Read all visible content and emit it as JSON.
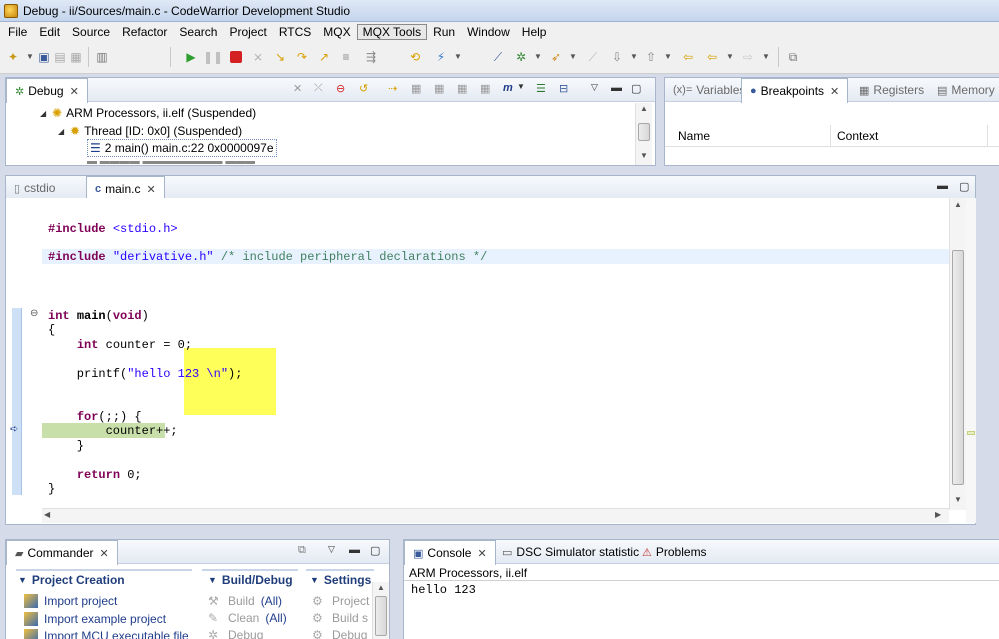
{
  "window": {
    "title": "Debug - ii/Sources/main.c - CodeWarrior Development Studio"
  },
  "menu": [
    "File",
    "Edit",
    "Source",
    "Refactor",
    "Search",
    "Project",
    "RTCS",
    "MQX",
    "MQX Tools",
    "Run",
    "Window",
    "Help"
  ],
  "debug_view": {
    "tab_label": "Debug",
    "tree": {
      "process": "ARM Processors, ii.elf (Suspended)",
      "thread": "Thread [ID: 0x0] (Suspended)",
      "frame": "2 main() main.c:22 0x0000097e"
    }
  },
  "right_view": {
    "tabs": [
      {
        "label": "Variables",
        "glyph": "(x)="
      },
      {
        "label": "Breakpoints",
        "glyph": "●"
      },
      {
        "label": "Registers",
        "glyph": "▦"
      },
      {
        "label": "Memory",
        "glyph": "▤"
      }
    ],
    "columns": [
      "Name",
      "Context"
    ]
  },
  "editor": {
    "tabs": [
      {
        "label": "cstdio"
      },
      {
        "label": "main.c"
      }
    ]
  },
  "commander": {
    "tab_label": "Commander",
    "sections": {
      "project_creation": {
        "title": "Project Creation",
        "items": [
          "Import project",
          "Import example project",
          "Import MCU executable file"
        ]
      },
      "build_debug": {
        "title": "Build/Debug",
        "items": [
          {
            "label": "Build",
            "suffix": "(All)"
          },
          {
            "label": "Clean",
            "suffix": "(All)"
          },
          {
            "label": "Debug",
            "suffix": ""
          }
        ]
      },
      "settings": {
        "title": "Settings",
        "items": [
          "Project",
          "Build s",
          "Debug"
        ]
      }
    }
  },
  "console_view": {
    "tabs": [
      {
        "label": "Console"
      },
      {
        "label": "DSC Simulator statistic"
      },
      {
        "label": "Problems"
      }
    ],
    "process_label": "ARM Processors, ii.elf",
    "output": "hello 123"
  },
  "colors": {
    "keyword": "#7f0055",
    "string": "#2a00ff",
    "comment": "#3f7f5f",
    "current_line": "#c8dfaa",
    "tooltip": "#ffff5a"
  }
}
